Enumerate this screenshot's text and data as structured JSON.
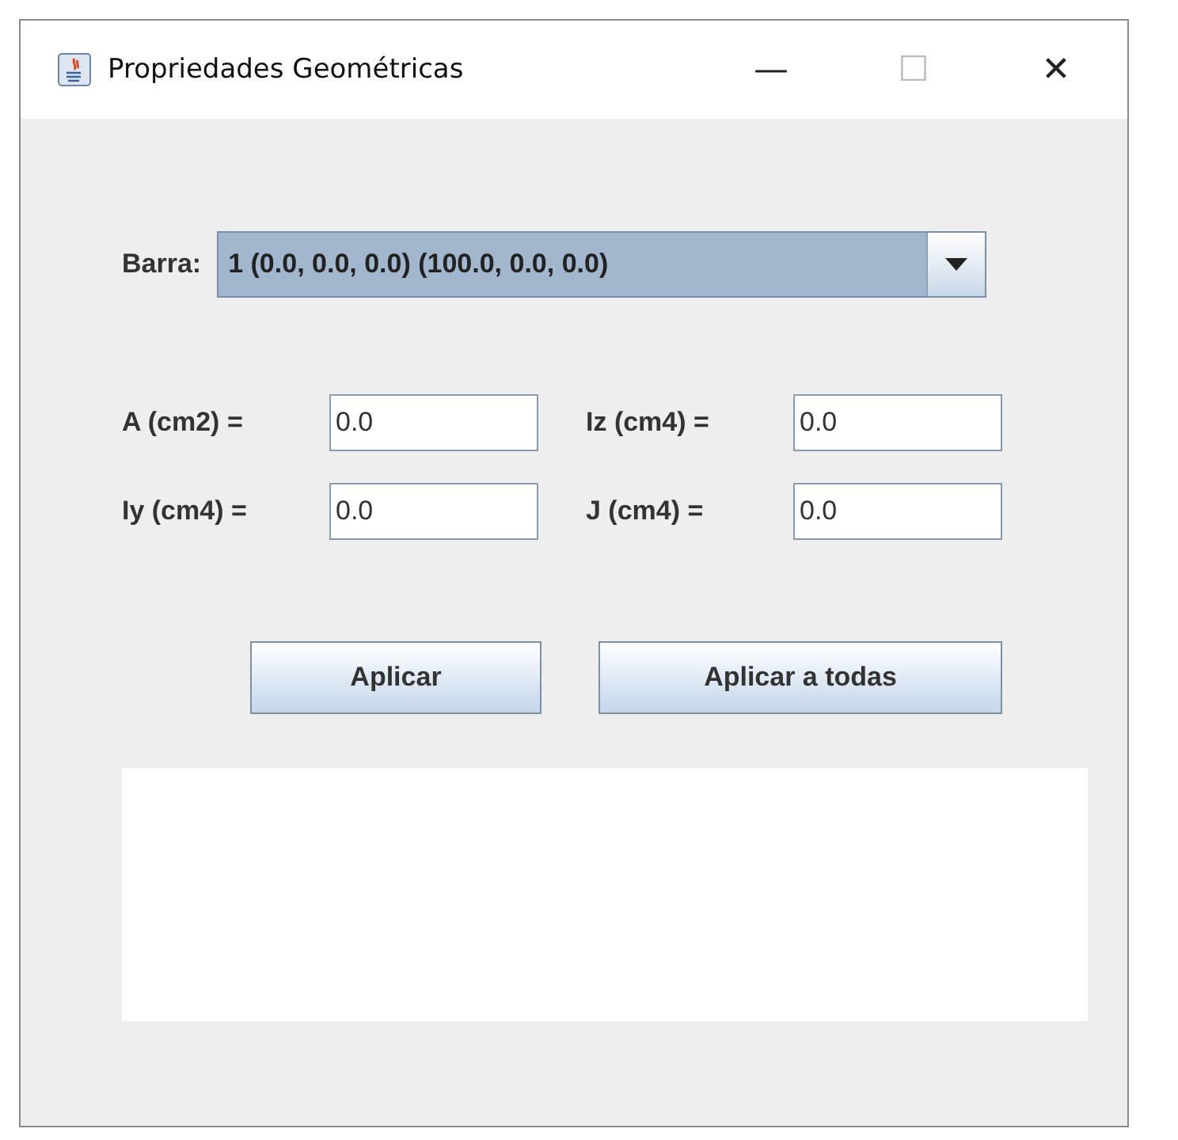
{
  "window": {
    "title": "Propriedades Geométricas",
    "controls": [
      "—",
      "☐",
      "✕"
    ]
  },
  "bar_selector": {
    "label": "Barra:",
    "value": "1 (0.0, 0.0, 0.0) (100.0, 0.0, 0.0)"
  },
  "fields": [
    {
      "label": "A (cm2) =",
      "value": "0.0"
    },
    {
      "label": "Iz (cm4) =",
      "value": "0.0"
    },
    {
      "label": "Iy (cm4) =",
      "value": "0.0"
    },
    {
      "label": "J (cm4) =",
      "value": "0.0"
    }
  ],
  "buttons": [
    "Aplicar",
    "Aplicar a todas"
  ]
}
